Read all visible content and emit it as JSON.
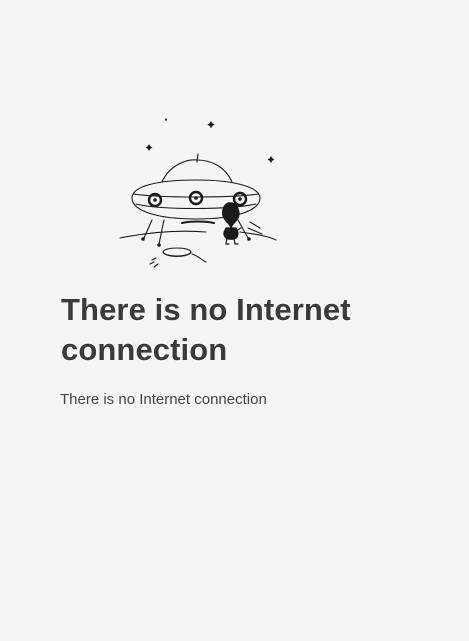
{
  "error": {
    "illustration_icon": "ufo-alien-icon",
    "title": "There is no Internet connection",
    "message": "There is no Internet connection"
  }
}
